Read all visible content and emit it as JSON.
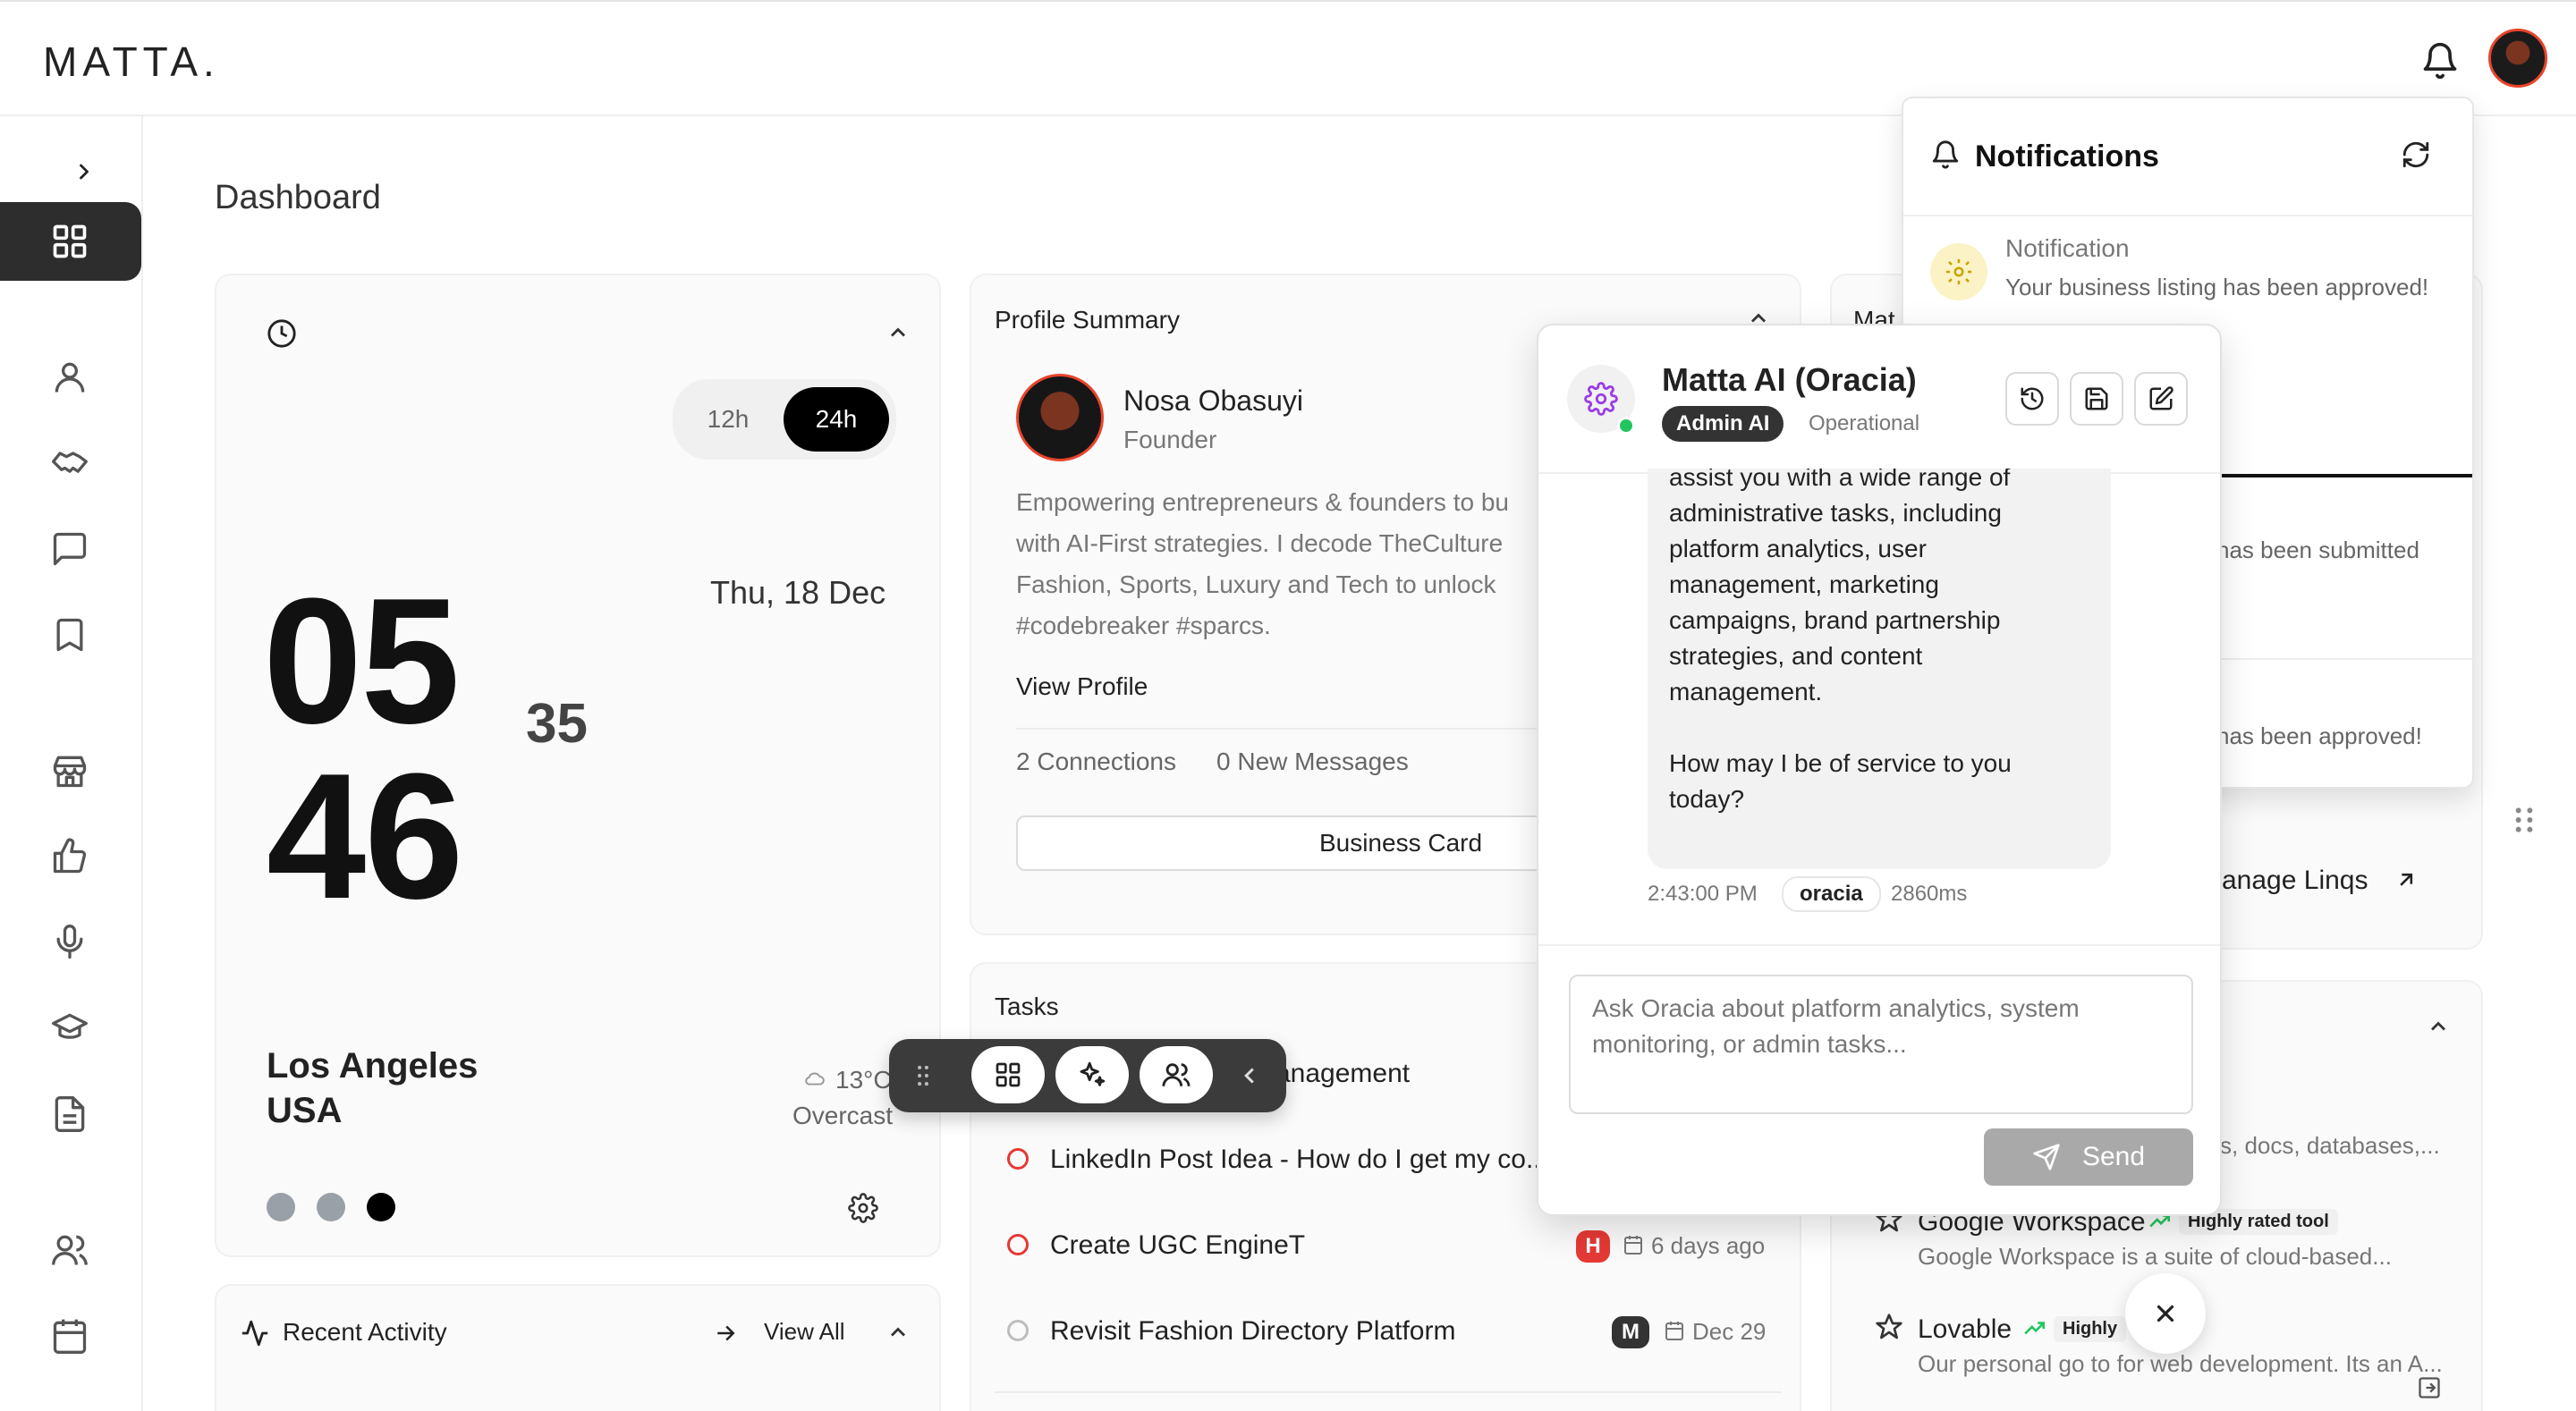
{
  "app": {
    "logo": "MATTA."
  },
  "page": {
    "title": "Dashboard"
  },
  "clock": {
    "format_12h": "12h",
    "format_24h": "24h",
    "selected_format": "24h",
    "hours": "05",
    "minutes": "46",
    "seconds": "35",
    "date": "Thu, 18 Dec",
    "city": "Los Angeles",
    "country": "USA",
    "temperature": "13°C",
    "condition": "Overcast"
  },
  "profile": {
    "section_title": "Profile Summary",
    "name": "Nosa Obasuyi",
    "role": "Founder",
    "bio_lines": [
      "Empowering entrepreneurs & founders to bu",
      "with AI-First strategies. I decode TheCulture",
      "Fashion, Sports, Luxury and Tech to unlock",
      "#codebreaker #sparcs."
    ],
    "view_profile": "View Profile",
    "connections": "2 Connections",
    "new_messages": "0 New Messages",
    "business_card": "Business Card"
  },
  "tasks": {
    "section_title": "Tasks",
    "items": [
      {
        "title": "anagement",
        "badge": "",
        "date": ""
      },
      {
        "title": "LinkedIn Post Idea - How do I get my co...",
        "badge": "",
        "date": ""
      },
      {
        "title": "Create UGC EngineT",
        "badge": "H",
        "date": "6 days ago"
      },
      {
        "title": "Revisit Fashion Directory Platform",
        "badge": "M",
        "date": "Dec 29"
      }
    ]
  },
  "recent_activity": {
    "title": "Recent Activity",
    "view_all": "View All"
  },
  "right_column": {
    "card1_title_fragment": "Mat",
    "manage_linqs": "anage Linqs",
    "tools_fragment": "s, docs, databases,...",
    "tools": [
      {
        "name": "Google Workspace",
        "tag": "Highly rated tool",
        "desc": "Google Workspace is a suite of cloud-based..."
      },
      {
        "name": "Lovable",
        "tag": "Highly",
        "desc": "Our personal go to for web development. Its an A..."
      }
    ]
  },
  "notifications": {
    "title": "Notifications",
    "items": [
      {
        "title": "Notification",
        "body": "Your business listing has been approved!"
      },
      {
        "title": "",
        "body": "has been submitted"
      },
      {
        "title": "",
        "body": "has been approved!"
      }
    ]
  },
  "chat": {
    "title": "Matta AI (Oracia)",
    "badge": "Admin AI",
    "status": "Operational",
    "message_lines": [
      "assist you with a wide range of",
      "administrative tasks, including",
      "platform analytics, user",
      "management, marketing",
      "campaigns, brand partnership",
      "strategies, and content",
      "management."
    ],
    "message_question_lines": [
      "How may I be of service to you",
      "today?"
    ],
    "time": "2:43:00 PM",
    "sender": "oracia",
    "latency": "2860ms",
    "input_placeholder": "Ask Oracia about platform analytics, system monitoring, or admin tasks...",
    "send": "Send"
  },
  "colors": {
    "accent_dark": "#2d2d2d",
    "online_green": "#22c55e",
    "task_red": "#e53935",
    "oracia_purple": "#9b3de6",
    "notif_yellow": "#f6e27a"
  }
}
